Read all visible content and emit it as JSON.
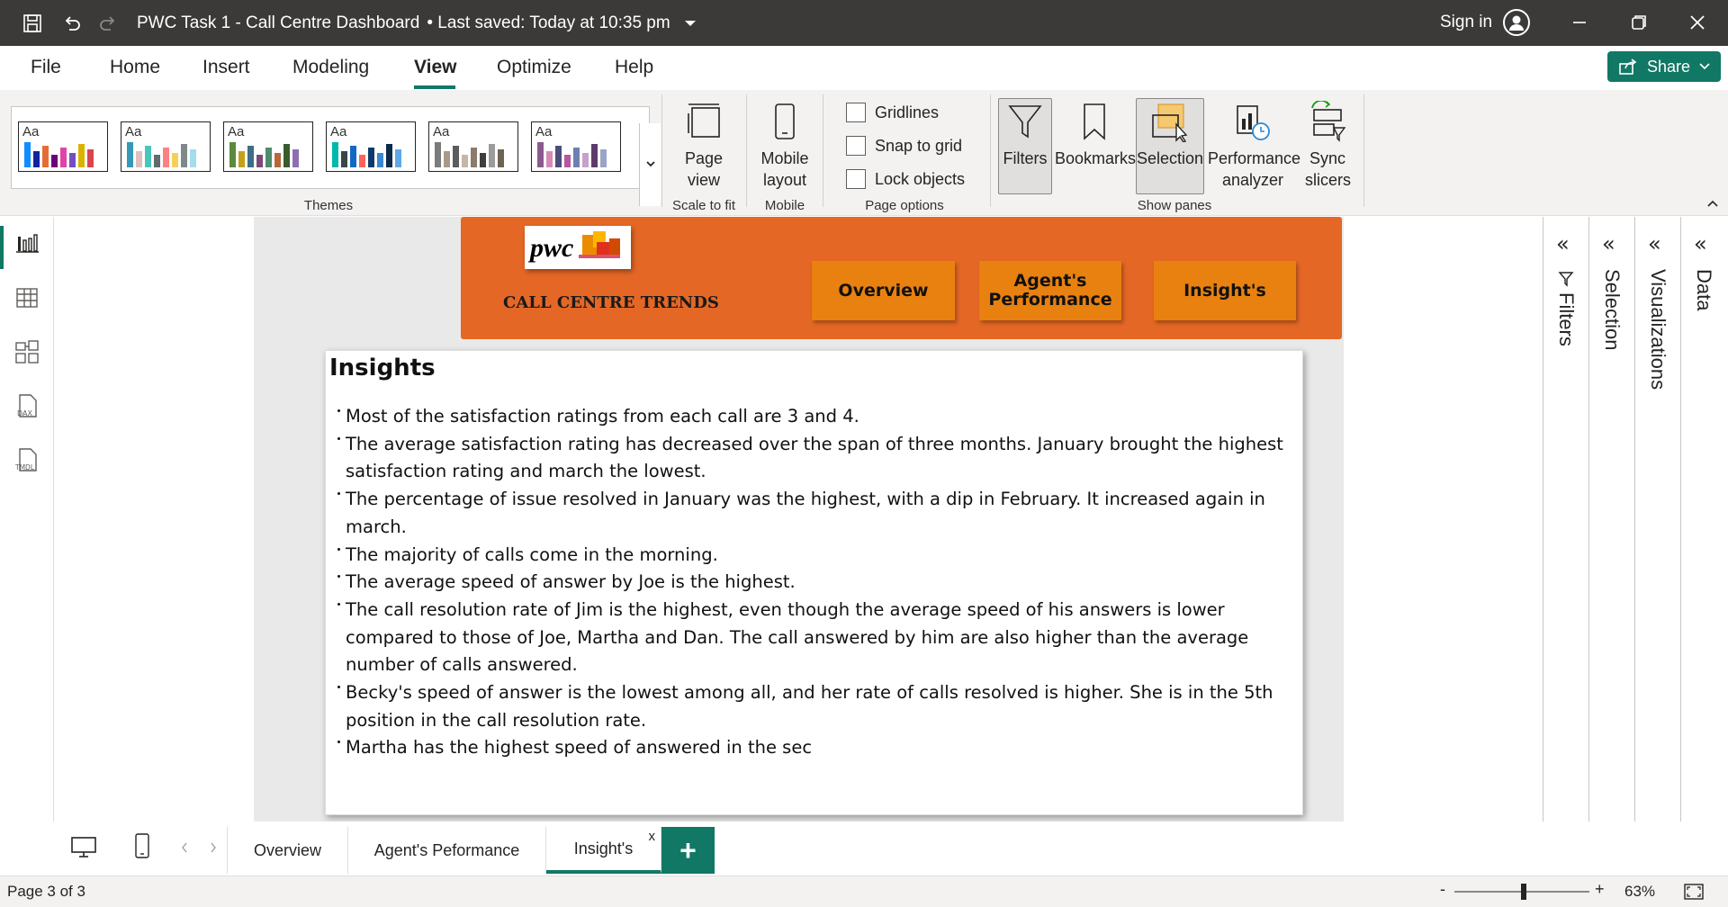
{
  "titlebar": {
    "title": "PWC Task 1 - Call Centre Dashboard",
    "saved": "•  Last saved: Today at 10:35 pm",
    "sign_in": "Sign in"
  },
  "menu": {
    "items": [
      "File",
      "Home",
      "Insert",
      "Modeling",
      "View",
      "Optimize",
      "Help"
    ],
    "active": "View",
    "share": "Share"
  },
  "ribbon": {
    "themes_label": "Themes",
    "theme_aa": "Aa",
    "page_view": "Page view",
    "scale_label": "Scale to fit",
    "mobile_layout": "Mobile layout",
    "mobile_label": "Mobile",
    "gridlines": "Gridlines",
    "snap": "Snap to grid",
    "lock": "Lock objects",
    "page_options_label": "Page options",
    "filters": "Filters",
    "bookmarks": "Bookmarks",
    "selection": "Selection",
    "performance": "Performance analyzer",
    "sync": "Sync slicers",
    "show_panes_label": "Show panes"
  },
  "report": {
    "logo_text": "pwc",
    "header_title": "CALL CENTRE TRENDS",
    "nav": {
      "overview": "Overview",
      "agents": "Agent's Performance",
      "insights": "Insight's"
    },
    "card_title": "Insights",
    "insights": [
      "Most of the satisfaction ratings from each call are 3 and 4.",
      "The average satisfaction rating has decreased over the span of three months. January brought the highest satisfaction rating and march the lowest.",
      "The percentage of issue resolved in January was the highest, with a dip in February. It increased again in march.",
      "The majority of calls come in the morning.",
      "The average speed of answer by Joe is the highest.",
      "The call resolution rate of Jim is the highest, even though the average speed of his answers is lower compared to those of Joe, Martha and Dan. The call answered by him are also higher than the average number of calls answered.",
      "Becky's speed of answer is the lowest among all, and her rate of calls resolved is higher. She is in the 5th position in the call resolution rate.",
      "Martha has the highest  speed of answered in the sec"
    ]
  },
  "panes": [
    "Filters",
    "Selection",
    "Visualizations",
    "Data"
  ],
  "pagetabs": {
    "tabs": [
      "Overview",
      "Agent's Peformance",
      "Insight's"
    ],
    "active": "Insight's",
    "close": "x"
  },
  "status": {
    "page": "Page 3 of 3",
    "zoom": "63%"
  },
  "colors": {
    "accent": "#117865",
    "header_orange": "#e46725",
    "button_orange": "#e8810f"
  }
}
